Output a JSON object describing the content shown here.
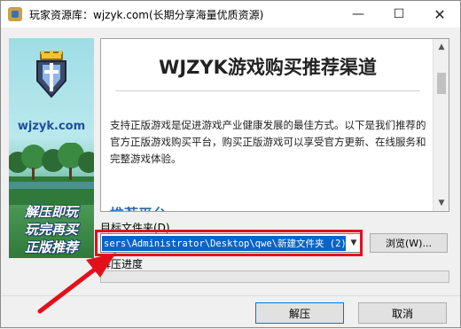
{
  "window": {
    "title": "玩家资源库：wjzyk.com(长期分享海量优质资源)"
  },
  "titlebar": {
    "minimize": "—",
    "maximize": "☐",
    "close": "✕"
  },
  "banner": {
    "site": "wjzyk.com",
    "slogan_lines": [
      "解压即玩",
      "玩完再买",
      "正版推荐"
    ]
  },
  "content": {
    "heading": "WJZYK游戏购买推荐渠道",
    "paragraph": "支持正版游戏是促进游戏产业健康发展的最佳方式。以下是我们推荐的官方正版游戏购买平台，购买正版游戏可以享受官方更新、在线服务和完整游戏体验。",
    "subheading": "推荐平台"
  },
  "form": {
    "target_label": "目标文件夹(D)",
    "path_value": "sers\\Administrator\\Desktop\\qwe\\新建文件夹 (2)",
    "browse_label": "浏览(W)...",
    "progress_label": "解压进度",
    "progress_fraction": 0
  },
  "buttons": {
    "extract": "解压",
    "cancel": "取消"
  },
  "colors": {
    "accent": "#0a64c8",
    "highlight": "#e3101b",
    "subheading": "#2f6fb5"
  }
}
